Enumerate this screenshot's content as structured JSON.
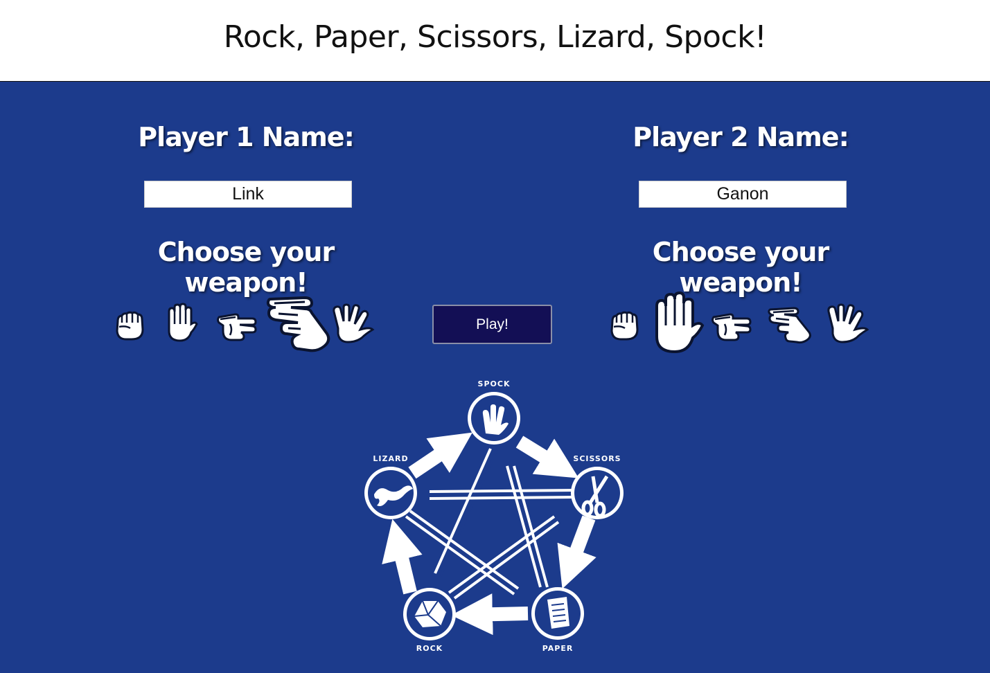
{
  "header": {
    "title": "Rock, Paper, Scissors, Lizard, Spock!"
  },
  "players": [
    {
      "title": "Player 1 Name:",
      "name_value": "Link",
      "weapon_prompt": "Choose your weapon!",
      "selected_weapon": "lizard",
      "weapons": [
        "rock",
        "paper",
        "scissors",
        "lizard",
        "spock"
      ]
    },
    {
      "title": "Player 2 Name:",
      "name_value": "Ganon",
      "weapon_prompt": "Choose your weapon!",
      "selected_weapon": "paper",
      "weapons": [
        "rock",
        "paper",
        "scissors",
        "lizard",
        "spock"
      ]
    }
  ],
  "play_button": {
    "label": "Play!"
  },
  "diagram": {
    "labels": {
      "spock": "SPOCK",
      "scissors": "SCISSORS",
      "paper": "PAPER",
      "rock": "ROCK",
      "lizard": "LIZARD"
    }
  },
  "colors": {
    "arena_background": "#1c3b8c",
    "play_button_background": "#130f55",
    "header_background": "#ffffff"
  }
}
